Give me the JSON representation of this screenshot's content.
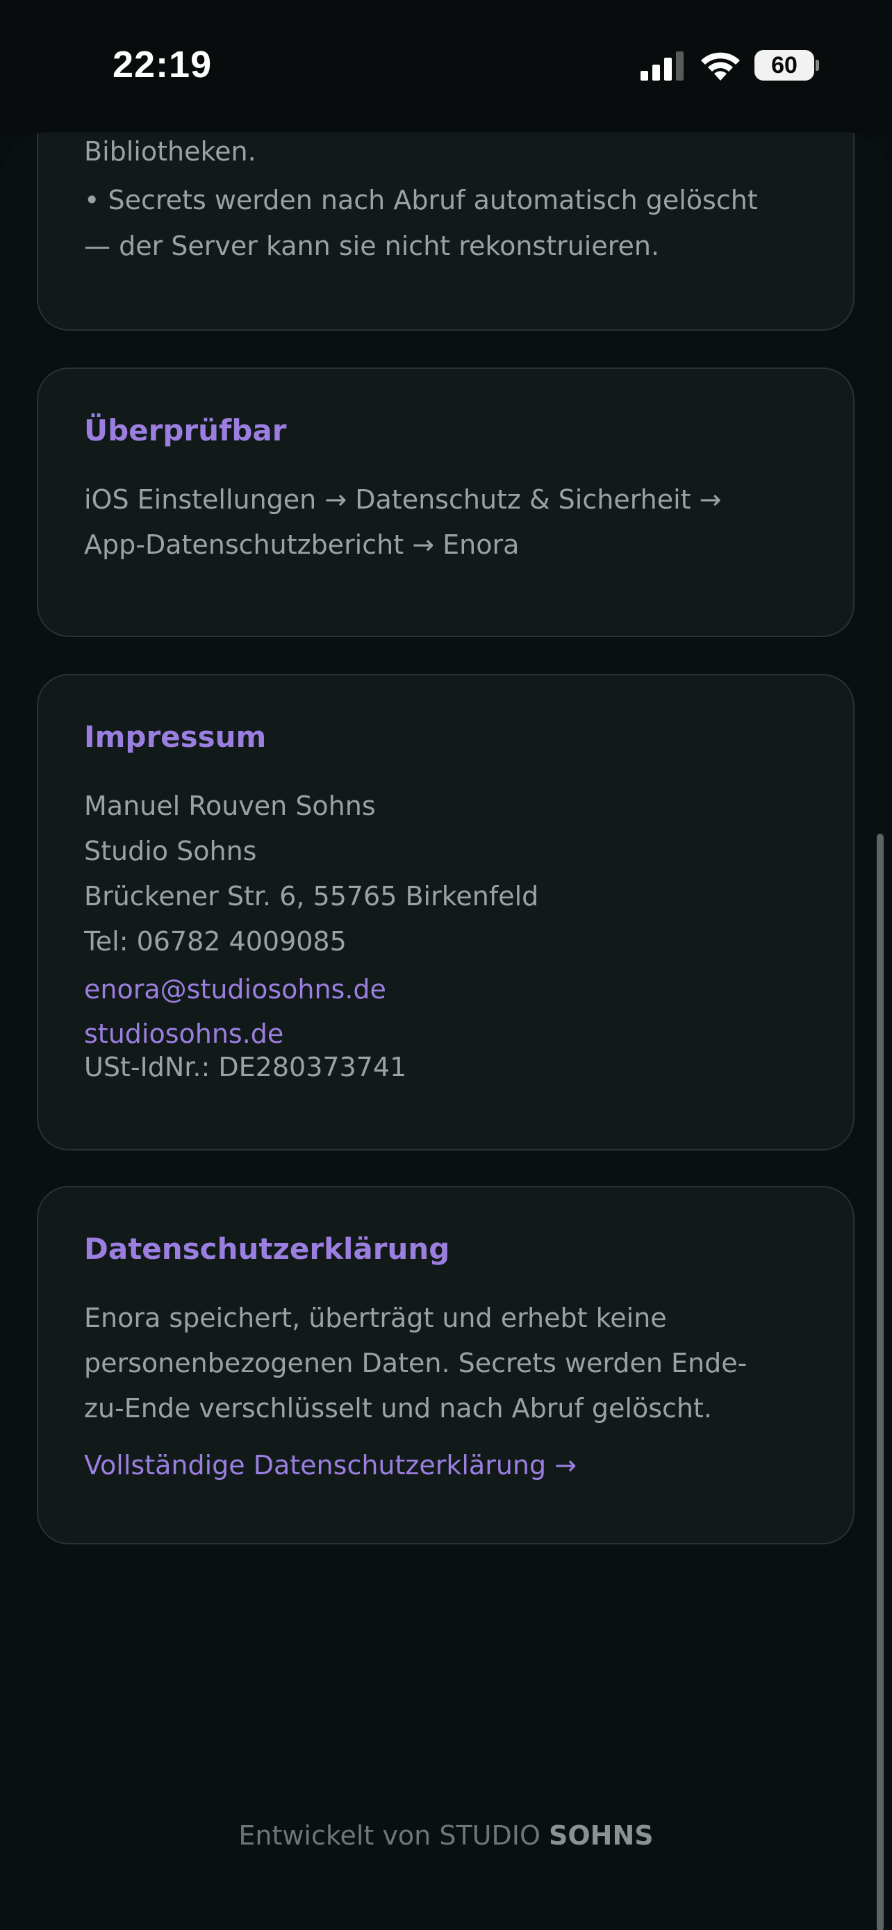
{
  "status_bar": {
    "time": "22:19",
    "battery_level": "60",
    "icons": [
      "signal-icon",
      "wifi-icon",
      "battery-icon"
    ]
  },
  "sections": {
    "privacy_cont": {
      "cut_line": "Bibliotheken.",
      "bullet_line1": "• Secrets werden nach Abruf automatisch gelöscht",
      "bullet_line2": "— der Server kann sie nicht rekonstruieren."
    },
    "verifiable": {
      "title": "Überprüfbar",
      "line1": "iOS Einstellungen → Datenschutz & Sicherheit →",
      "line2": "App-Datenschutzbericht → Enora"
    },
    "imprint": {
      "title": "Impressum",
      "name": "Manuel Rouven Sohns",
      "company": "Studio Sohns",
      "address": "Brückener Str. 6, 55765 Birkenfeld",
      "phone": "Tel: 06782 4009085",
      "email": "enora@studiosohns.de",
      "website": "studiosohns.de",
      "vat": "USt-IdNr.: DE280373741"
    },
    "privacy_policy": {
      "title": "Datenschutzerklärung",
      "line1": "Enora speichert, überträgt und erhebt keine",
      "line2": "personenbezogenen Daten. Secrets werden Ende-",
      "line3": "zu-Ende verschlüsselt und nach Abruf gelöscht.",
      "link": "Vollständige Datenschutzerklärung →"
    }
  },
  "footer": {
    "prefix": "Entwickelt von STUDIO",
    "brand": "SOHNS"
  },
  "colors": {
    "accent": "#9b7fe0",
    "background": "#080d0d",
    "card": "#121919",
    "text": "#9aa2a2"
  }
}
